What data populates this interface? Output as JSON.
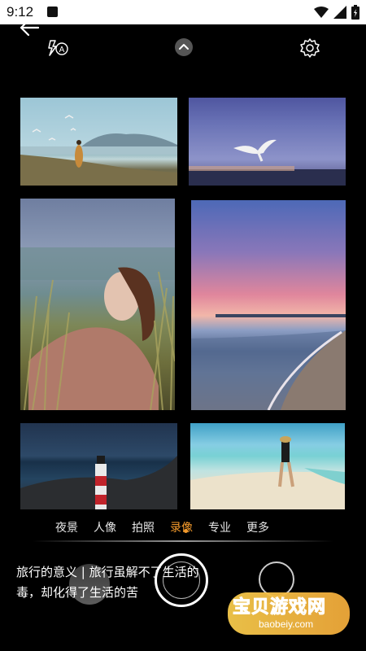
{
  "status": {
    "time": "9:12"
  },
  "modes": [
    {
      "label": "夜景",
      "active": false
    },
    {
      "label": "人像",
      "active": false
    },
    {
      "label": "拍照",
      "active": false
    },
    {
      "label": "录像",
      "active": true
    },
    {
      "label": "专业",
      "active": false
    },
    {
      "label": "更多",
      "active": false
    }
  ],
  "caption": "旅行的意义 | 旅行虽解不了生活的毒，却化得了生活的苦",
  "watermark": {
    "text": "宝贝游戏网",
    "url": "baobeiy.com"
  },
  "icons": {
    "back": "arrow-left-icon",
    "flash": "flash-auto-icon",
    "collapse": "chevron-up-icon",
    "settings": "gear-icon"
  },
  "colors": {
    "accent": "#f39a2c",
    "background": "#000000"
  }
}
